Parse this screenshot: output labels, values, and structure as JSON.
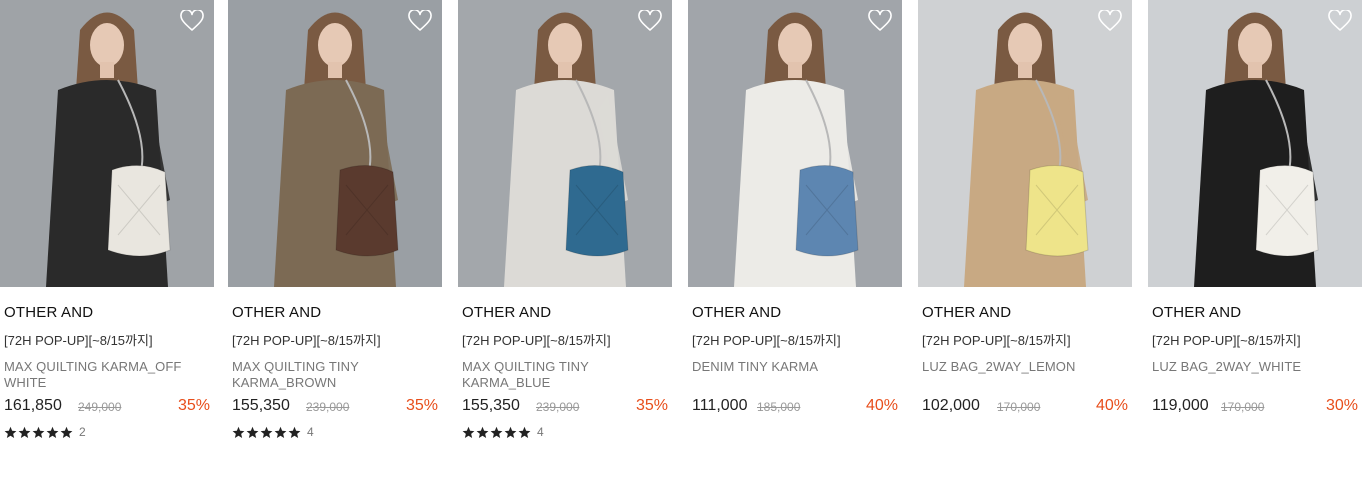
{
  "products": [
    {
      "brand": "OTHER AND",
      "promo": "[72H POP-UP][~8/15까지]",
      "name": "MAX QUILTING KARMA_OFF WHITE",
      "price": "161,850",
      "original_price": "249,000",
      "discount": "35%",
      "review_count": "2",
      "has_rating": true,
      "bag_color": "#e9e6df",
      "outfit_color": "#2a2a2a",
      "bg_color": "#9fa3a7",
      "wishlist_icon": "heart-outline-icon"
    },
    {
      "brand": "OTHER AND",
      "promo": "[72H POP-UP][~8/15까지]",
      "name": "MAX QUILTING TINY KARMA_BROWN",
      "price": "155,350",
      "original_price": "239,000",
      "discount": "35%",
      "review_count": "4",
      "has_rating": true,
      "bag_color": "#5a3a2e",
      "outfit_color": "#7c6a54",
      "bg_color": "#9a9fa4",
      "wishlist_icon": "heart-outline-icon"
    },
    {
      "brand": "OTHER AND",
      "promo": "[72H POP-UP][~8/15까지]",
      "name": "MAX QUILTING TINY KARMA_BLUE",
      "price": "155,350",
      "original_price": "239,000",
      "discount": "35%",
      "review_count": "4",
      "has_rating": true,
      "bag_color": "#2f6a90",
      "outfit_color": "#dcdad6",
      "bg_color": "#a3a7ab",
      "wishlist_icon": "heart-outline-icon"
    },
    {
      "brand": "OTHER AND",
      "promo": "[72H POP-UP][~8/15까지]",
      "name": "DENIM TINY KARMA",
      "price": "111,000",
      "original_price": "185,000",
      "discount": "40%",
      "review_count": "",
      "has_rating": false,
      "bag_color": "#5d86b1",
      "outfit_color": "#ecebe7",
      "bg_color": "#a1a5aa",
      "wishlist_icon": "heart-outline-icon"
    },
    {
      "brand": "OTHER AND",
      "promo": "[72H POP-UP][~8/15까지]",
      "name": "LUZ BAG_2WAY_LEMON",
      "price": "102,000",
      "original_price": "170,000",
      "discount": "40%",
      "review_count": "",
      "has_rating": false,
      "bag_color": "#eee48a",
      "outfit_color": "#c8a983",
      "bg_color": "#cfd1d3",
      "wishlist_icon": "heart-outline-icon"
    },
    {
      "brand": "OTHER AND",
      "promo": "[72H POP-UP][~8/15까지]",
      "name": "LUZ BAG_2WAY_WHITE",
      "price": "119,000",
      "original_price": "170,000",
      "discount": "30%",
      "review_count": "",
      "has_rating": false,
      "bag_color": "#f1efe9",
      "outfit_color": "#1e1e1e",
      "bg_color": "#cdd0d3",
      "wishlist_icon": "heart-outline-icon"
    }
  ]
}
